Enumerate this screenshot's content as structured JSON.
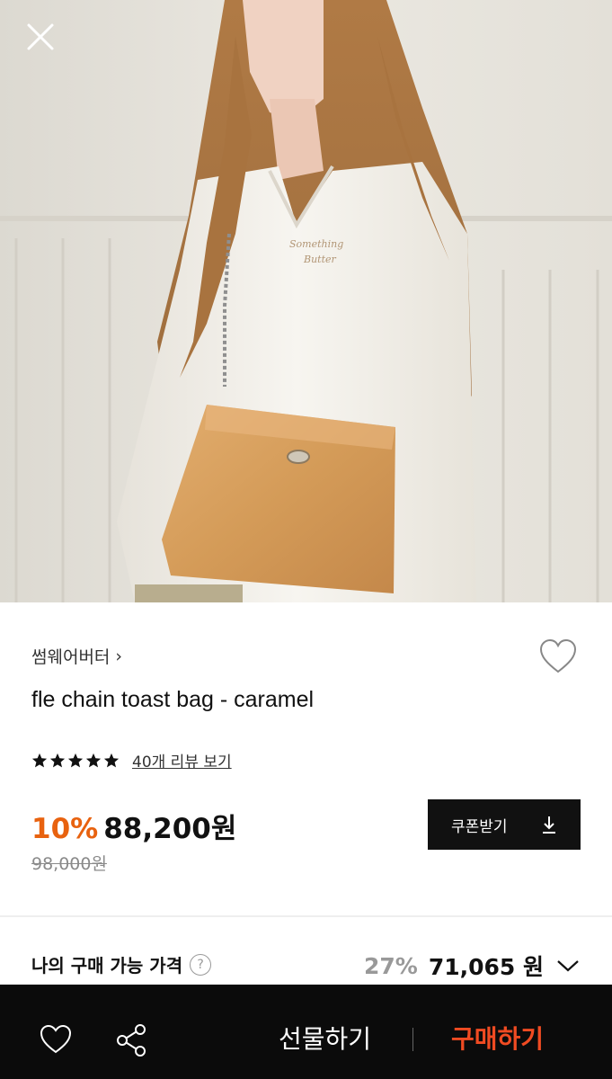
{
  "product": {
    "brand": "썸웨어버터",
    "brand_chevron": "›",
    "name": "fle chain toast bag - caramel",
    "rating_stars": 5,
    "review_link": "40개 리뷰 보기",
    "discount": "10%",
    "price": "88,200원",
    "original_price": "98,000원"
  },
  "coupon": {
    "label": "쿠폰받기"
  },
  "my_price": {
    "label": "나의 구매 가능 가격",
    "help": "?",
    "discount": "27%",
    "value": "71,065 원"
  },
  "bottom_bar": {
    "gift_label": "선물하기",
    "buy_label": "구매하기"
  },
  "colors": {
    "accent_orange": "#e8620f",
    "buy_red": "#f04b22",
    "bar_bg": "#0b0b0b"
  },
  "icons": [
    "close-icon",
    "heart-icon",
    "star-icon",
    "download-icon",
    "help-icon",
    "chevron-down-icon",
    "share-icon"
  ]
}
